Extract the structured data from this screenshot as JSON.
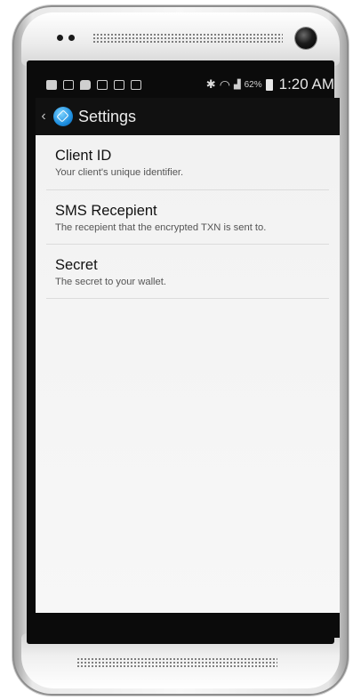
{
  "status_bar": {
    "battery_percent": "62%",
    "time": "1:20 AM"
  },
  "action_bar": {
    "back_glyph": "‹",
    "title": "Settings",
    "app_icon": "app-logo-icon"
  },
  "preferences": [
    {
      "title": "Client ID",
      "summary": "Your client's unique identifier."
    },
    {
      "title": "SMS Recepient",
      "summary": "The recepient that the encrypted TXN is sent to."
    },
    {
      "title": "Secret",
      "summary": "The secret to your wallet."
    }
  ],
  "colors": {
    "screen_bg": "#f2f2f2",
    "action_bar_bg": "#111111",
    "app_icon_accent": "#1e8fe0"
  }
}
